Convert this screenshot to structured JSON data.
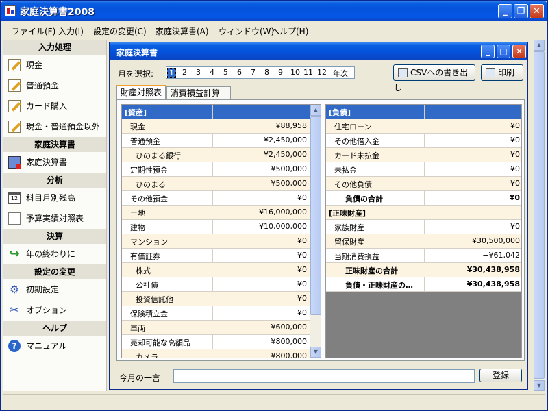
{
  "app": {
    "title": "家庭決算書2008",
    "window_buttons": {
      "minimize": "_",
      "maximize": "❐",
      "close": "✕"
    }
  },
  "menu": [
    "ファイル(F)",
    "入力(I)",
    "設定の変更(C)",
    "家庭決算書(A)",
    "ウィンドウ(W)",
    "ヘルプ(H)"
  ],
  "sidebar": {
    "sections": [
      {
        "header": "入力処理",
        "items": [
          {
            "label": "現金",
            "icon": "pencil-note-icon"
          },
          {
            "label": "普通預金",
            "icon": "pencil-note-icon"
          },
          {
            "label": "カード購入",
            "icon": "pencil-note-icon"
          },
          {
            "label": "現金・普通預金以外",
            "icon": "pencil-note-icon"
          }
        ]
      },
      {
        "header": "家庭決算書",
        "items": [
          {
            "label": "家庭決算書",
            "icon": "ledger-book-icon"
          }
        ]
      },
      {
        "header": "分析",
        "items": [
          {
            "label": "科目月別残高",
            "icon": "calendar-icon"
          },
          {
            "label": "予算実績対照表",
            "icon": "report-edit-icon"
          }
        ]
      },
      {
        "header": "決算",
        "items": [
          {
            "label": "年の終わりに",
            "icon": "green-arrow-icon"
          }
        ]
      },
      {
        "header": "設定の変更",
        "items": [
          {
            "label": "初期設定",
            "icon": "settings-icon"
          },
          {
            "label": "オプション",
            "icon": "tools-icon"
          }
        ]
      },
      {
        "header": "ヘルプ",
        "items": [
          {
            "label": "マニュアル",
            "icon": "help-icon"
          }
        ]
      }
    ]
  },
  "mdi": {
    "title": "家庭決算書",
    "month_label": "月を選択:",
    "months": [
      "1",
      "2",
      "3",
      "4",
      "5",
      "6",
      "7",
      "8",
      "9",
      "10",
      "11",
      "12",
      "年次"
    ],
    "selected_month": "1",
    "csv_button": "CSVへの書き出し",
    "print_button": "印刷",
    "tabs": [
      "財産対照表",
      "消費損益計算書"
    ],
    "active_tab": 0,
    "assets": {
      "header": "[資産]",
      "rows": [
        {
          "label": "現金",
          "value": "¥88,958",
          "indent": 1
        },
        {
          "label": "普通預金",
          "value": "¥2,450,000",
          "indent": 1
        },
        {
          "label": "ひのまる銀行",
          "value": "¥2,450,000",
          "indent": 2
        },
        {
          "label": "定期性預金",
          "value": "¥500,000",
          "indent": 1
        },
        {
          "label": "ひのまる",
          "value": "¥500,000",
          "indent": 2
        },
        {
          "label": "その他預金",
          "value": "¥0",
          "indent": 1
        },
        {
          "label": "土地",
          "value": "¥16,000,000",
          "indent": 1
        },
        {
          "label": "建物",
          "value": "¥10,000,000",
          "indent": 1
        },
        {
          "label": "マンション",
          "value": "¥0",
          "indent": 1
        },
        {
          "label": "有価証券",
          "value": "¥0",
          "indent": 1
        },
        {
          "label": "株式",
          "value": "¥0",
          "indent": 2
        },
        {
          "label": "公社債",
          "value": "¥0",
          "indent": 2
        },
        {
          "label": "投資信託他",
          "value": "¥0",
          "indent": 2
        },
        {
          "label": "保険積立金",
          "value": "¥0",
          "indent": 1
        },
        {
          "label": "車両",
          "value": "¥600,000",
          "indent": 1
        },
        {
          "label": "売却可能な高額品",
          "value": "¥800,000",
          "indent": 1
        },
        {
          "label": "カメラ",
          "value": "¥800,000",
          "indent": 2
        }
      ]
    },
    "liabilities": {
      "header": "[負債]",
      "rows": [
        {
          "label": "住宅ローン",
          "value": "¥0",
          "indent": 1,
          "bold": false
        },
        {
          "label": "その他借入金",
          "value": "¥0",
          "indent": 1,
          "bold": false
        },
        {
          "label": "カード未払金",
          "value": "¥0",
          "indent": 1,
          "bold": false
        },
        {
          "label": "未払金",
          "value": "¥0",
          "indent": 1,
          "bold": false
        },
        {
          "label": "その他負債",
          "value": "¥0",
          "indent": 1,
          "bold": false
        },
        {
          "label": "負債の合計",
          "value": "¥0",
          "indent": 3,
          "bold": true
        },
        {
          "label": "[正味財産]",
          "value": "",
          "indent": 0,
          "bold": true
        },
        {
          "label": "家族財産",
          "value": "¥0",
          "indent": 1,
          "bold": false
        },
        {
          "label": "留保財産",
          "value": "¥30,500,000",
          "indent": 1,
          "bold": false
        },
        {
          "label": "当期消費損益",
          "value": "−¥61,042",
          "indent": 1,
          "bold": false
        },
        {
          "label": "正味財産の合計",
          "value": "¥30,438,958",
          "indent": 3,
          "bold": true
        },
        {
          "label": "負債・正味財産の…",
          "value": "¥30,438,958",
          "indent": 3,
          "bold": true
        }
      ]
    },
    "comment_label": "今月の一言",
    "comment_value": "",
    "register_button": "登録"
  }
}
